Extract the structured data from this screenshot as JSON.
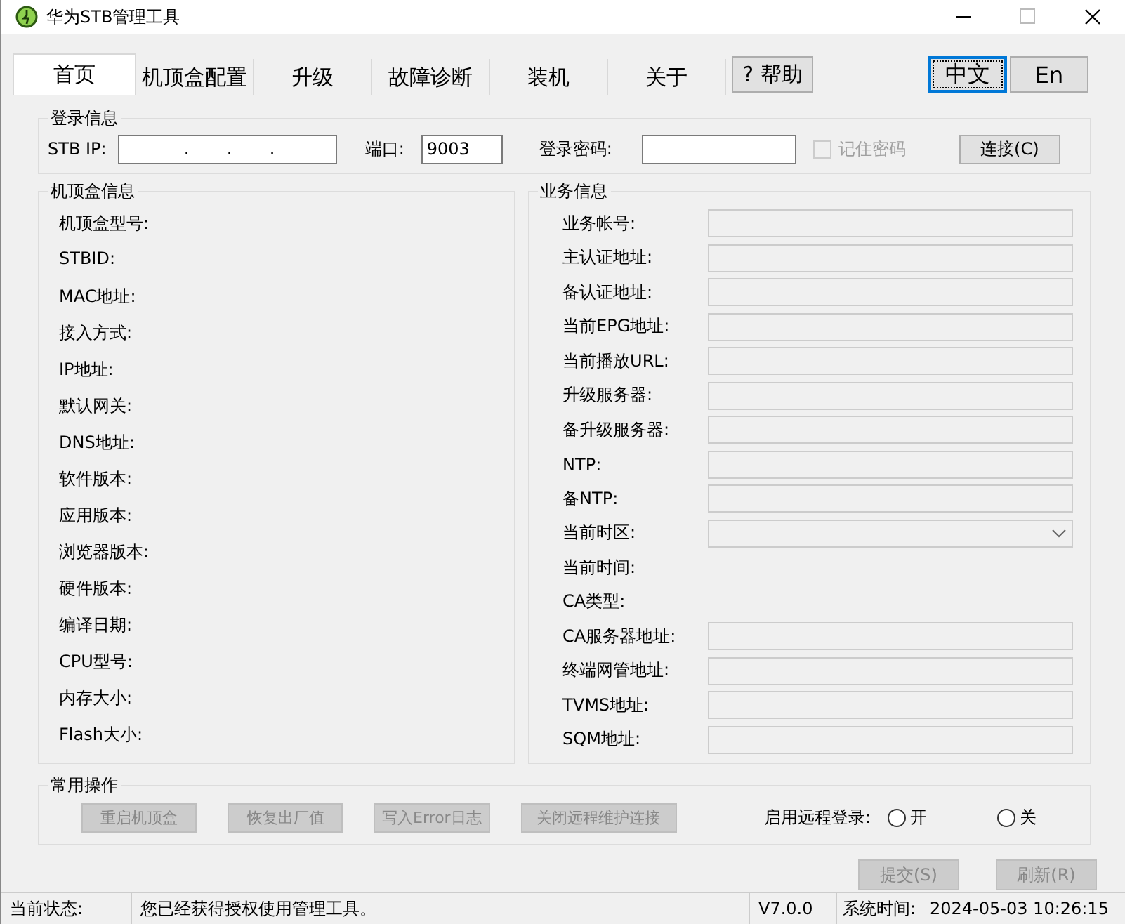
{
  "window": {
    "title": "华为STB管理工具"
  },
  "tabs": [
    {
      "label": "首页",
      "selected": true
    },
    {
      "label": "机顶盒配置",
      "selected": false
    },
    {
      "label": "升级",
      "selected": false
    },
    {
      "label": "故障诊断",
      "selected": false
    },
    {
      "label": "装机",
      "selected": false
    },
    {
      "label": "关于",
      "selected": false
    }
  ],
  "help_button": "? 帮助",
  "language_buttons": [
    {
      "label": "中文",
      "selected": true
    },
    {
      "label": "En",
      "selected": false
    }
  ],
  "login": {
    "title": "登录信息",
    "ip_label": "STB IP:",
    "ip_value": ".       .       .",
    "port_label": "端口:",
    "port_value": "9003",
    "password_label": "登录密码:",
    "remember": {
      "label": "记住密码",
      "checked": false,
      "disabled": true
    },
    "connect_button": "连接(C)"
  },
  "stb_info": {
    "title": "机顶盒信息",
    "items": [
      "机顶盒型号:",
      "STBID:",
      "MAC地址:",
      "接入方式:",
      "IP地址:",
      "默认网关:",
      "DNS地址:",
      "软件版本:",
      "应用版本:",
      "浏览器版本:",
      "硬件版本:",
      "编译日期:",
      "CPU型号:",
      "内存大小:",
      "Flash大小:"
    ]
  },
  "service_info": {
    "title": "业务信息",
    "items": [
      {
        "label": "业务帐号:",
        "kind": "field"
      },
      {
        "label": "主认证地址:",
        "kind": "field"
      },
      {
        "label": "备认证地址:",
        "kind": "field"
      },
      {
        "label": "当前EPG地址:",
        "kind": "field"
      },
      {
        "label": "当前播放URL:",
        "kind": "field"
      },
      {
        "label": "升级服务器:",
        "kind": "field"
      },
      {
        "label": "备升级服务器:",
        "kind": "field"
      },
      {
        "label": "NTP:",
        "kind": "field"
      },
      {
        "label": "备NTP:",
        "kind": "field"
      },
      {
        "label": "当前时区:",
        "kind": "dropdown"
      },
      {
        "label": "当前时间:",
        "kind": "text"
      },
      {
        "label": "CA类型:",
        "kind": "text"
      },
      {
        "label": "CA服务器地址:",
        "kind": "field"
      },
      {
        "label": "终端网管地址:",
        "kind": "field"
      },
      {
        "label": "TVMS地址:",
        "kind": "field"
      },
      {
        "label": "SQM地址:",
        "kind": "field"
      }
    ]
  },
  "operations": {
    "title": "常用操作",
    "buttons": [
      {
        "label": "重启机顶盒",
        "disabled": true
      },
      {
        "label": "恢复出厂值",
        "disabled": true
      },
      {
        "label": "写入Error日志",
        "disabled": true
      },
      {
        "label": "关闭远程维护连接",
        "disabled": true
      }
    ],
    "remote_login_label": "启用远程登录:",
    "options": [
      {
        "label": "开",
        "selected": false
      },
      {
        "label": "关",
        "selected": false
      }
    ]
  },
  "action_buttons": [
    {
      "label": "提交(S)",
      "disabled": true
    },
    {
      "label": "刷新(R)",
      "disabled": true
    }
  ],
  "status_bar": {
    "label": "当前状态:",
    "message": "您已经获得授权使用管理工具。",
    "version": "V7.0.0",
    "time_label": "系统时间:",
    "time": "2024-05-03 10:26:15"
  }
}
